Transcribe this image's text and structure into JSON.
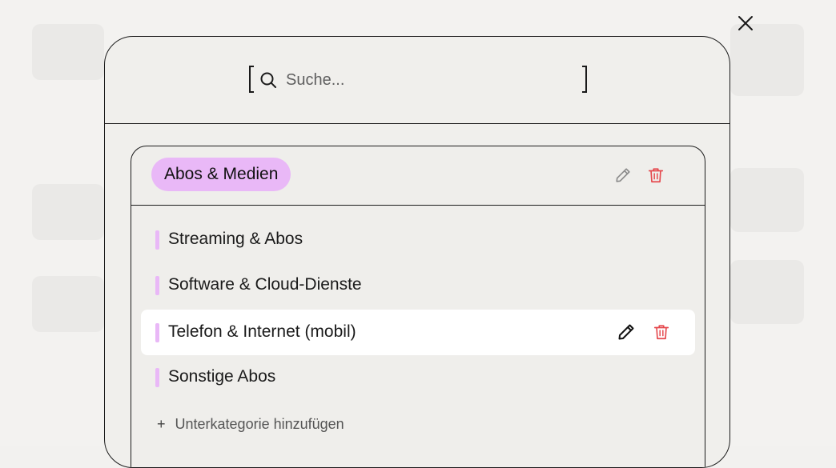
{
  "search": {
    "placeholder": "Suche..."
  },
  "category": {
    "name": "Abos & Medien",
    "color": "#e9b8f7",
    "subcategories": [
      {
        "label": "Streaming & Abos",
        "highlighted": false
      },
      {
        "label": "Software & Cloud-Dienste",
        "highlighted": false
      },
      {
        "label": "Telefon & Internet (mobil)",
        "highlighted": true
      },
      {
        "label": "Sonstige Abos",
        "highlighted": false
      }
    ],
    "add_subcategory_label": "Unterkategorie hinzufügen"
  },
  "colors": {
    "accent": "#e9b8f7",
    "delete": "#e5484d",
    "border": "#1c1c1c"
  },
  "icons": {
    "close": "close-icon",
    "search": "search-icon",
    "edit": "pencil-icon",
    "delete": "trash-icon"
  }
}
